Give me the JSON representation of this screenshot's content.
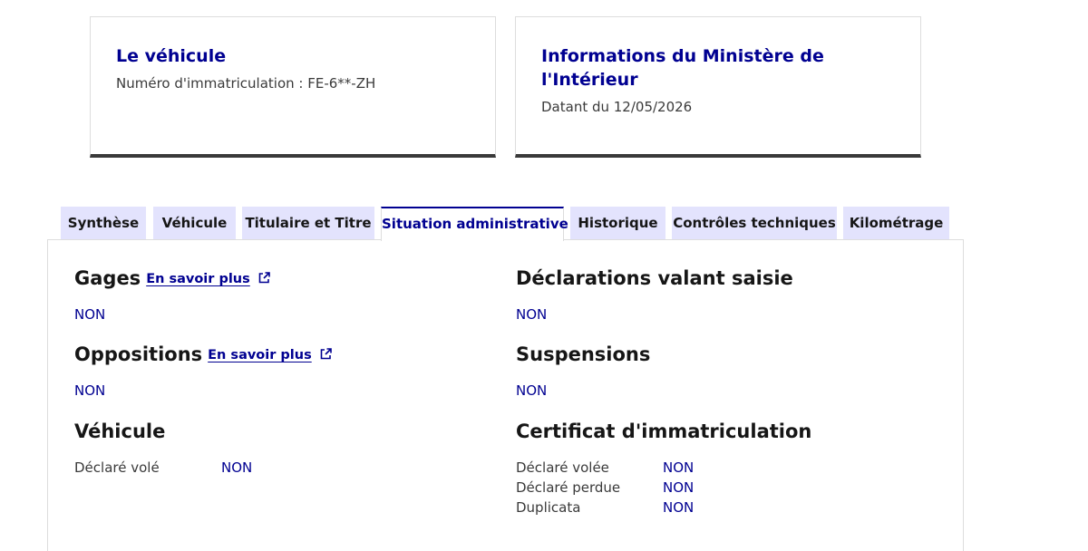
{
  "cards": {
    "vehicle": {
      "title": "Le véhicule",
      "subtitle": "Numéro d'immatriculation : FE-6**-ZH"
    },
    "ministry": {
      "title": "Informations du Ministère de l'Intérieur",
      "subtitle": "Datant du 12/05/2026"
    }
  },
  "tabs": [
    {
      "label": "Synthèse"
    },
    {
      "label": "Véhicule"
    },
    {
      "label": "Titulaire et Titre"
    },
    {
      "label": "Situation administrative",
      "active": true
    },
    {
      "label": "Historique"
    },
    {
      "label": "Contrôles techniques"
    },
    {
      "label": "Kilométrage"
    }
  ],
  "colors": {
    "accent": "#000091",
    "tab_bg": "#e3e3fd",
    "card_border_bottom": "#3a3a3a"
  },
  "sections": {
    "gages": {
      "title": "Gages",
      "link": "En savoir plus",
      "link_icon": "external-link-icon",
      "value": "NON"
    },
    "oppositions": {
      "title": "Oppositions",
      "link": "En savoir plus",
      "link_icon": "external-link-icon",
      "value": "NON"
    },
    "vehicule": {
      "title": "Véhicule",
      "rows": [
        {
          "label": "Déclaré volé",
          "value": "NON"
        }
      ]
    },
    "declarations": {
      "title": "Déclarations valant saisie",
      "value": "NON"
    },
    "suspensions": {
      "title": "Suspensions",
      "value": "NON"
    },
    "certificat": {
      "title": "Certificat d'immatriculation",
      "rows": [
        {
          "label": "Déclaré volée",
          "value": "NON"
        },
        {
          "label": "Déclaré perdue",
          "value": "NON"
        },
        {
          "label": "Duplicata",
          "value": "NON"
        }
      ]
    }
  }
}
